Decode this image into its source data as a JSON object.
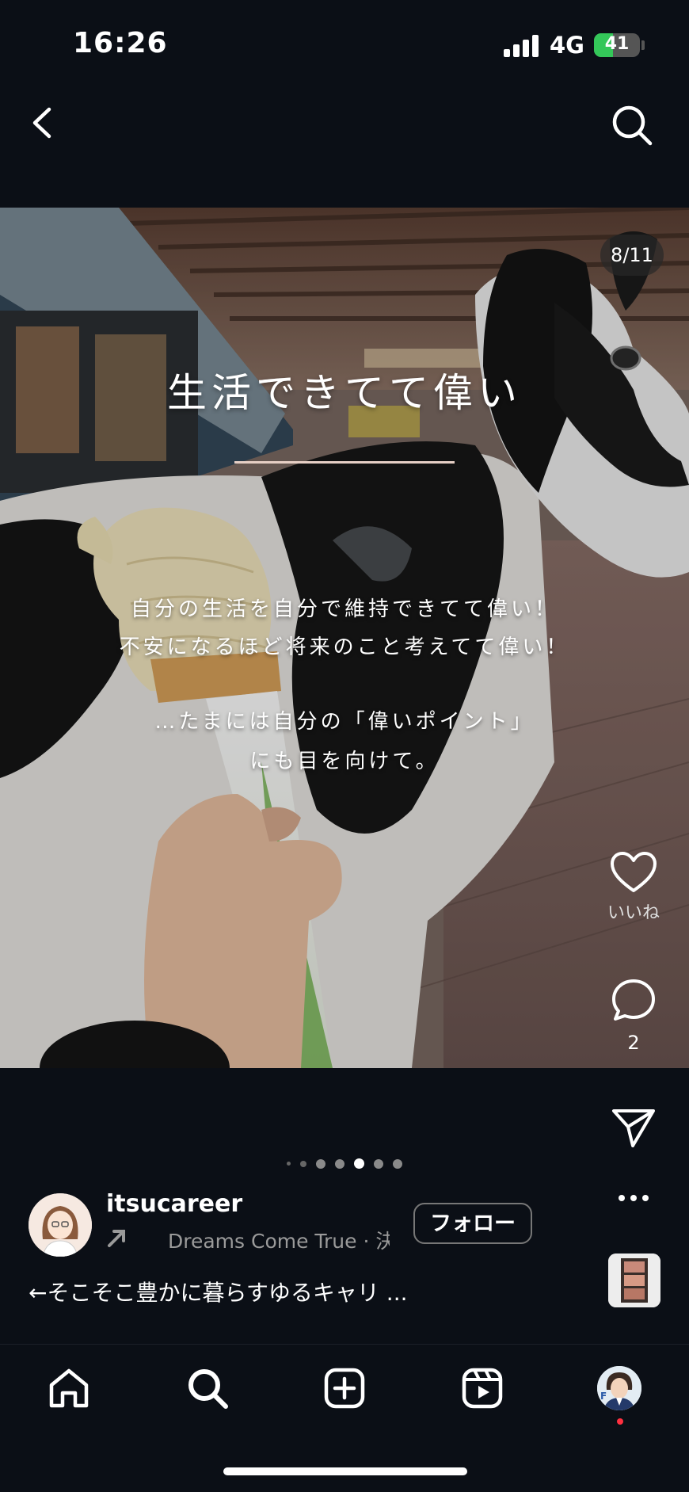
{
  "status": {
    "time": "16:26",
    "network": "4G",
    "battery": "41",
    "battery_level": 0.41
  },
  "post": {
    "counter": "8/11",
    "title": "生活できてて偉い",
    "body_lines": [
      "自分の生活を自分で維持できてて偉い！",
      "不安になるほど将来のこと考えてて偉い！",
      "…たまには自分の「偉いポイント」",
      "にも目を向けて。"
    ]
  },
  "actions": {
    "like_label": "いいね",
    "comment_count": "2"
  },
  "carousel": {
    "count": 7,
    "active_index": 4
  },
  "user": {
    "username": "itsucareer",
    "music": "Dreams Come True · 決",
    "follow_label": "フォロー",
    "caption": "←そこそこ豊かに暮らすゆるキャリ ..."
  },
  "nav": {
    "items": [
      "home-icon",
      "search-icon",
      "create-icon",
      "reels-icon",
      "profile-avatar"
    ]
  },
  "colors": {
    "background": "#0b0f16",
    "battery": "#34c759",
    "notification": "#ff3040"
  }
}
